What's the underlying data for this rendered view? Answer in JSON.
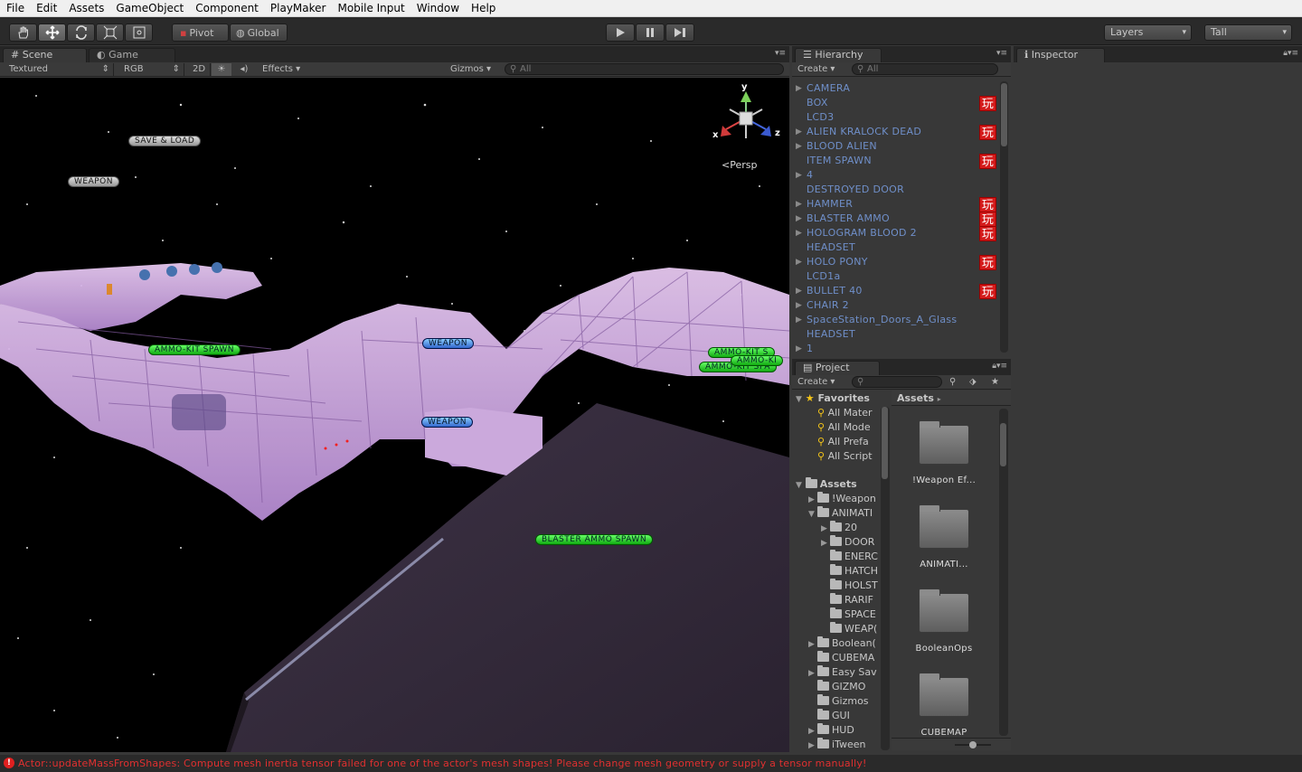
{
  "menu": [
    "File",
    "Edit",
    "Assets",
    "GameObject",
    "Component",
    "PlayMaker",
    "Mobile Input",
    "Window",
    "Help"
  ],
  "toolbar": {
    "tools": [
      "hand-tool-icon",
      "move-tool-icon",
      "rotate-tool-icon",
      "scale-tool-icon",
      "rect-tool-icon"
    ],
    "pivot_label": "Pivot",
    "global_label": "Global",
    "layers_label": "Layers",
    "layout_label": "Tall"
  },
  "scene_panel": {
    "tab_scene": "Scene",
    "tab_game": "Game",
    "shading": "Textured",
    "render_mode": "RGB",
    "btn_2d": "2D",
    "effects": "Effects",
    "gizmos": "Gizmos",
    "search_placeholder": "All",
    "persp_label": "Persp",
    "gizmo_axes": {
      "x": "x",
      "y": "y",
      "z": "z"
    },
    "labels": {
      "save_load": "SAVE & LOAD",
      "weapon_top": "WEAPON",
      "ammo_kit_spawn": "AMMO-KIT SPAWN",
      "weapon_mid": "WEAPON",
      "weapon_low": "WEAPON",
      "ammo_kit_right_a": "AMMO-KIT S",
      "ammo_kit_right_b": "AMMO-KI",
      "ammo_kit_right_c": "AMMO-KIT SPA",
      "blaster_ammo_spawn": "BLASTER AMMO SPAWN"
    }
  },
  "hierarchy": {
    "tab": "Hierarchy",
    "create": "Create",
    "search_placeholder": "All",
    "items": [
      {
        "label": "CAMERA",
        "expand": true,
        "pm": false
      },
      {
        "label": "BOX",
        "expand": false,
        "pm": true
      },
      {
        "label": "LCD3",
        "expand": false,
        "pm": false
      },
      {
        "label": "ALIEN KRALOCK DEAD",
        "expand": true,
        "pm": true
      },
      {
        "label": "BLOOD ALIEN",
        "expand": true,
        "pm": false
      },
      {
        "label": "ITEM SPAWN",
        "expand": false,
        "pm": true
      },
      {
        "label": "4",
        "expand": true,
        "pm": false
      },
      {
        "label": "DESTROYED DOOR",
        "expand": false,
        "pm": false
      },
      {
        "label": "HAMMER",
        "expand": true,
        "pm": true
      },
      {
        "label": "BLASTER AMMO",
        "expand": true,
        "pm": true
      },
      {
        "label": "HOLOGRAM BLOOD 2",
        "expand": true,
        "pm": true
      },
      {
        "label": "HEADSET",
        "expand": false,
        "pm": false
      },
      {
        "label": "HOLO PONY",
        "expand": true,
        "pm": true
      },
      {
        "label": "LCD1a",
        "expand": false,
        "pm": false
      },
      {
        "label": "BULLET 40",
        "expand": true,
        "pm": true
      },
      {
        "label": "CHAIR 2",
        "expand": true,
        "pm": false
      },
      {
        "label": "SpaceStation_Doors_A_Glass",
        "expand": true,
        "pm": false
      },
      {
        "label": "HEADSET",
        "expand": false,
        "pm": false
      },
      {
        "label": "1",
        "expand": true,
        "pm": false
      }
    ],
    "pm_glyph": "玩"
  },
  "project": {
    "tab": "Project",
    "create": "Create",
    "favorites_title": "Favorites",
    "favorites": [
      "All Mater",
      "All Mode",
      "All Prefa",
      "All Script"
    ],
    "assets_root": "Assets",
    "tree": [
      {
        "label": "!Weapon",
        "depth": 1,
        "expand": true
      },
      {
        "label": "ANIMATI",
        "depth": 1,
        "expand": true,
        "open": true
      },
      {
        "label": "20",
        "depth": 2,
        "expand": true
      },
      {
        "label": "DOOR",
        "depth": 2,
        "expand": true
      },
      {
        "label": "ENERC",
        "depth": 2,
        "expand": false
      },
      {
        "label": "HATCH",
        "depth": 2,
        "expand": false
      },
      {
        "label": "HOLST",
        "depth": 2,
        "expand": false
      },
      {
        "label": "RARIF",
        "depth": 2,
        "expand": false
      },
      {
        "label": "SPACE",
        "depth": 2,
        "expand": false
      },
      {
        "label": "WEAP(",
        "depth": 2,
        "expand": false
      },
      {
        "label": "Boolean(",
        "depth": 1,
        "expand": true
      },
      {
        "label": "CUBEMA",
        "depth": 1,
        "expand": false
      },
      {
        "label": "Easy Sav",
        "depth": 1,
        "expand": true
      },
      {
        "label": "GIZMO",
        "depth": 1,
        "expand": false
      },
      {
        "label": "Gizmos",
        "depth": 1,
        "expand": false
      },
      {
        "label": "GUI",
        "depth": 1,
        "expand": false
      },
      {
        "label": "HUD",
        "depth": 1,
        "expand": true
      },
      {
        "label": "iTween",
        "depth": 1,
        "expand": true
      }
    ],
    "breadcrumb": "Assets",
    "grid_items": [
      "!Weapon Ef...",
      "ANIMATI...",
      "BooleanOps",
      "CUBEMAP"
    ]
  },
  "inspector": {
    "tab": "Inspector"
  },
  "status": {
    "message": "Actor::updateMassFromShapes: Compute mesh inertia tensor failed for one of the actor's mesh shapes! Please change mesh geometry or supply a tensor manually!",
    "color": "#e03030"
  }
}
